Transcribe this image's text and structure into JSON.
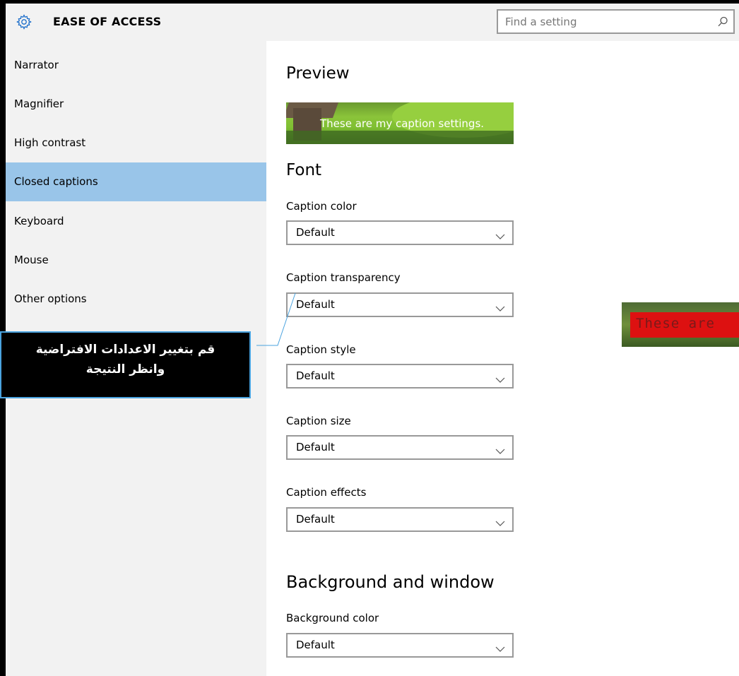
{
  "header": {
    "title": "EASE OF ACCESS",
    "settings_icon": "gear-icon",
    "search": {
      "placeholder": "Find a setting",
      "icon": "search-icon"
    }
  },
  "sidebar": {
    "items": [
      {
        "label": "Narrator",
        "active": false
      },
      {
        "label": "Magnifier",
        "active": false
      },
      {
        "label": "High contrast",
        "active": false
      },
      {
        "label": "Closed captions",
        "active": true
      },
      {
        "label": "Keyboard",
        "active": false
      },
      {
        "label": "Mouse",
        "active": false
      },
      {
        "label": "Other options",
        "active": false
      }
    ]
  },
  "main": {
    "preview_heading": "Preview",
    "preview_caption": "These are my caption settings.",
    "font_heading": "Font",
    "font_fields": [
      {
        "label": "Caption color",
        "value": "Default"
      },
      {
        "label": "Caption transparency",
        "value": "Default"
      },
      {
        "label": "Caption style",
        "value": "Default"
      },
      {
        "label": "Caption size",
        "value": "Default"
      },
      {
        "label": "Caption effects",
        "value": "Default"
      }
    ],
    "background_heading": "Background and window",
    "background_fields": [
      {
        "label": "Background color",
        "value": "Default"
      }
    ]
  },
  "annotation": {
    "line1": "قم بتغيير الاعدادات الافتراضية",
    "line2": "وانظر النتيجة"
  },
  "sample_caption": "These are",
  "colors": {
    "active_nav": "#99c5e9",
    "sidebar_bg": "#f2f2f2",
    "callout_border": "#4aa3df",
    "sample_band": "#dd1111"
  }
}
